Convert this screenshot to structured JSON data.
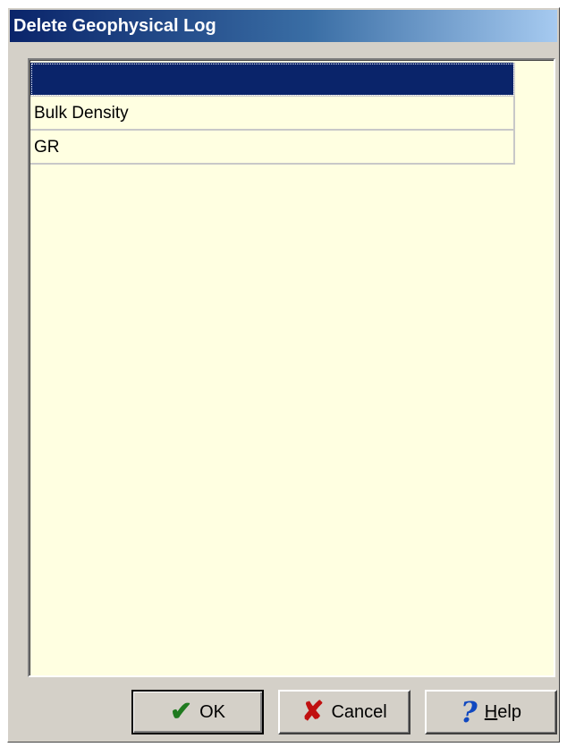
{
  "window": {
    "title": "Delete Geophysical Log"
  },
  "list": {
    "rows": [
      {
        "label": ""
      },
      {
        "label": "Bulk Density"
      },
      {
        "label": "GR"
      }
    ]
  },
  "buttons": {
    "ok_label": "OK",
    "cancel_label": "Cancel",
    "help_label": "Help"
  },
  "icons": {
    "ok": "check-icon",
    "cancel": "x-icon",
    "help": "question-icon"
  },
  "colors": {
    "titlebar_start": "#0a246a",
    "list_background": "#ffffe1",
    "selection": "#0a246a"
  }
}
